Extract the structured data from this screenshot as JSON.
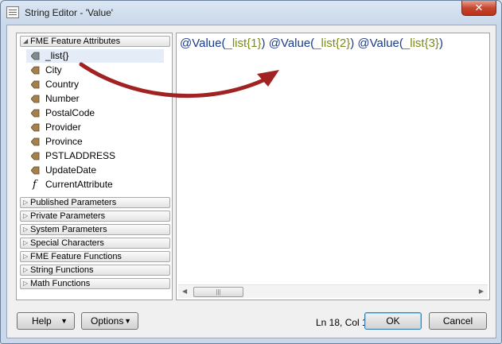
{
  "window": {
    "title": "String Editor - 'Value'",
    "close_symbol": "✕"
  },
  "tree": {
    "feature_attributes": {
      "label": "FME Feature Attributes",
      "items": [
        {
          "label": "_list{}",
          "icon": "list-attribute-icon",
          "selected": true
        },
        {
          "label": "City",
          "icon": "attribute-icon"
        },
        {
          "label": "Country",
          "icon": "attribute-icon"
        },
        {
          "label": "Number",
          "icon": "attribute-icon"
        },
        {
          "label": "PostalCode",
          "icon": "attribute-icon"
        },
        {
          "label": "Provider",
          "icon": "attribute-icon"
        },
        {
          "label": "Province",
          "icon": "attribute-icon"
        },
        {
          "label": "PSTLADDRESS",
          "icon": "attribute-icon"
        },
        {
          "label": "UpdateDate",
          "icon": "attribute-icon"
        },
        {
          "label": "CurrentAttribute",
          "icon": "function-icon"
        }
      ]
    },
    "groups": [
      "Published Parameters",
      "Private Parameters",
      "System Parameters",
      "Special Characters",
      "FME Feature Functions",
      "String Functions",
      "Math Functions"
    ]
  },
  "editor": {
    "tokens": [
      {
        "text": "@Value(",
        "kind": "fn"
      },
      {
        "text": "_list{1}",
        "kind": "arg"
      },
      {
        "text": ") ",
        "kind": "fn"
      },
      {
        "text": "@Value(",
        "kind": "fn"
      },
      {
        "text": "_list{2}",
        "kind": "arg"
      },
      {
        "text": ") ",
        "kind": "fn"
      },
      {
        "text": "@Value(",
        "kind": "fn"
      },
      {
        "text": "_list{3}",
        "kind": "arg"
      },
      {
        "text": ")",
        "kind": "fn"
      }
    ]
  },
  "footer": {
    "help_label": "Help",
    "options_label": "Options",
    "cursor_position": "Ln 18, Col 1",
    "ok_label": "OK",
    "cancel_label": "Cancel"
  },
  "colors": {
    "function_text": "#1a3b8e",
    "argument_text": "#7c8a17",
    "annotation_arrow": "#a12222",
    "attribute_icon": "#a6804a"
  }
}
